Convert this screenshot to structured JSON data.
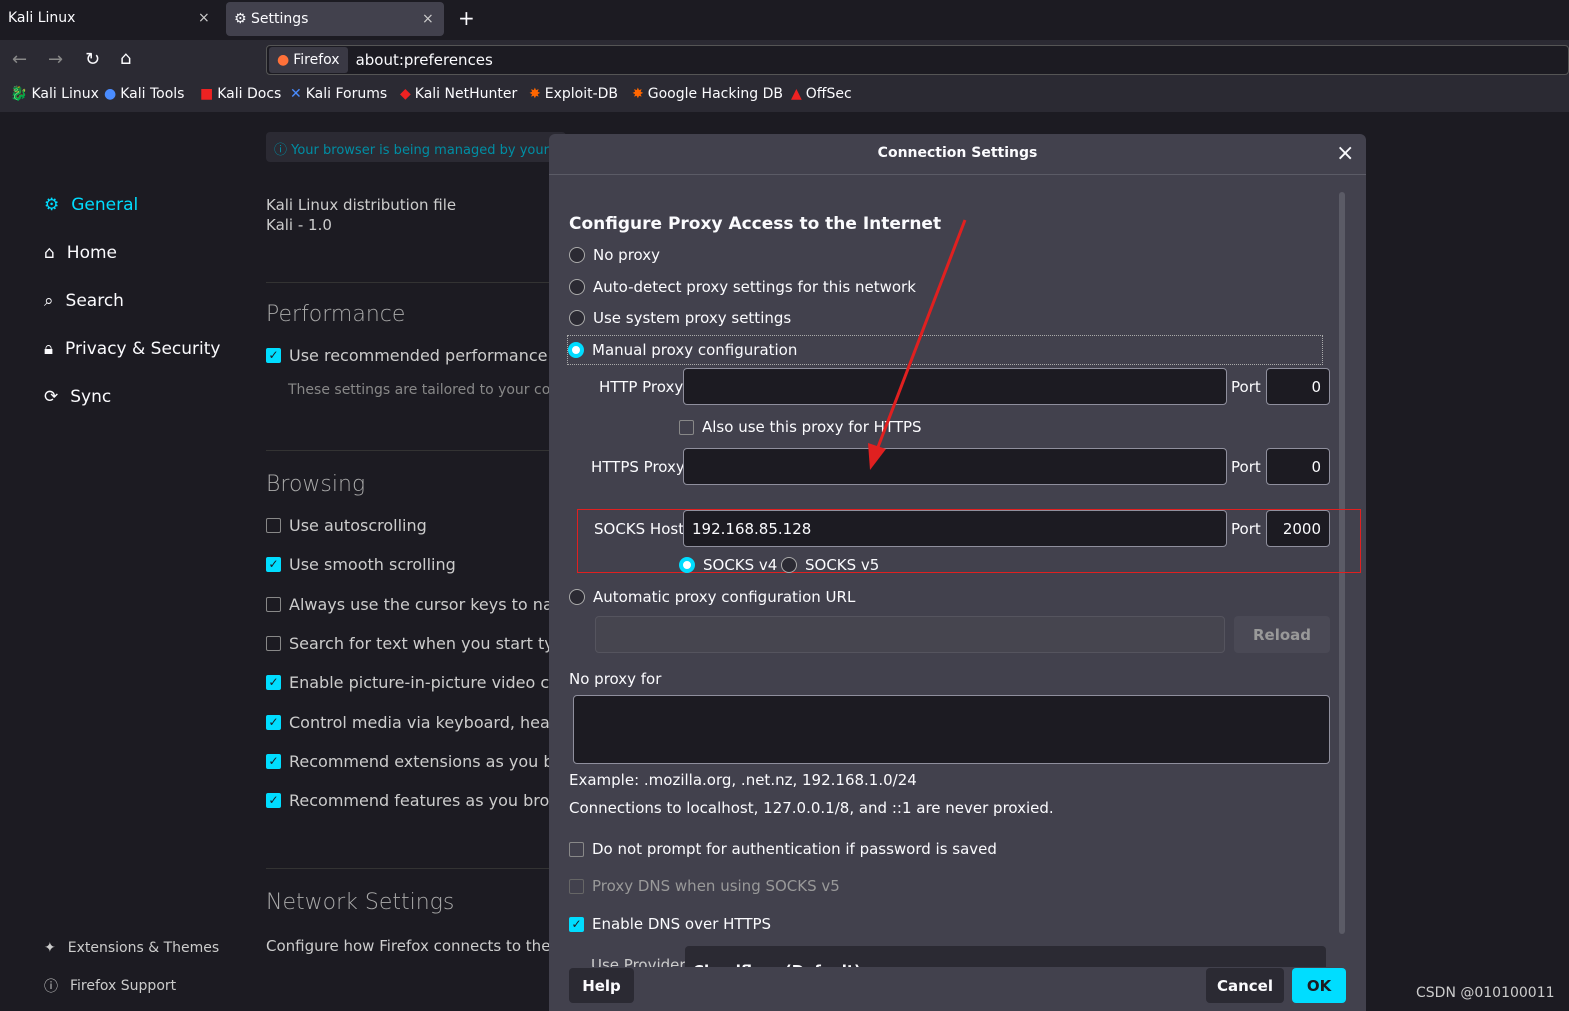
{
  "tabs": [
    {
      "label": "Kali Linux",
      "active": false
    },
    {
      "label": "Settings",
      "active": true
    }
  ],
  "toolbar": {
    "identity": "Firefox",
    "url": "about:preferences"
  },
  "bookmarks": [
    "Kali Linux",
    "Kali Tools",
    "Kali Docs",
    "Kali Forums",
    "Kali NetHunter",
    "Exploit-DB",
    "Google Hacking DB",
    "OffSec"
  ],
  "sidebar": {
    "items": [
      "General",
      "Home",
      "Search",
      "Privacy & Security",
      "Sync"
    ],
    "footer": [
      "Extensions & Themes",
      "Firefox Support"
    ]
  },
  "main": {
    "notice": "Your browser is being managed by your or",
    "dist_line1": "Kali Linux distribution file",
    "dist_line2": "Kali - 1.0",
    "performance": "Performance",
    "perf_check": "Use recommended performance sett",
    "perf_note": "These settings are tailored to your comp",
    "browsing": "Browsing",
    "browse_items": [
      {
        "label": "Use autoscrolling",
        "checked": false
      },
      {
        "label": "Use smooth scrolling",
        "checked": true
      },
      {
        "label": "Always use the cursor keys to naviga",
        "checked": false
      },
      {
        "label": "Search for text when you start typing",
        "checked": false
      },
      {
        "label": "Enable picture-in-picture video cont",
        "checked": true
      },
      {
        "label": "Control media via keyboard, headset",
        "checked": true
      },
      {
        "label": "Recommend extensions as you brow",
        "checked": true
      },
      {
        "label": "Recommend features as you browse",
        "checked": true
      }
    ],
    "network": "Network Settings",
    "network_desc": "Configure how Firefox connects to the i"
  },
  "dialog": {
    "title": "Connection Settings",
    "heading": "Configure Proxy Access to the Internet",
    "options": [
      "No proxy",
      "Auto-detect proxy settings for this network",
      "Use system proxy settings",
      "Manual proxy configuration"
    ],
    "selected": "Manual proxy configuration",
    "http_label": "HTTP Proxy",
    "http_value": "",
    "http_port": "0",
    "port_label": "Port",
    "also_https": "Also use this proxy for HTTPS",
    "https_label": "HTTPS Proxy",
    "https_value": "",
    "https_port": "0",
    "socks_label": "SOCKS Host",
    "socks_value": "192.168.85.128",
    "socks_port": "2000",
    "socks_v4": "SOCKS v4",
    "socks_v5": "SOCKS v5",
    "socks_selected": "SOCKS v4",
    "auto_url": "Automatic proxy configuration URL",
    "reload": "Reload",
    "no_proxy_label": "No proxy for",
    "example": "Example: .mozilla.org, .net.nz, 192.168.1.0/24",
    "localhost_note": "Connections to localhost, 127.0.0.1/8, and ::1 are never proxied.",
    "no_prompt": "Do not prompt for authentication if password is saved",
    "proxy_dns": "Proxy DNS when using SOCKS v5",
    "doh": "Enable DNS over HTTPS",
    "provider_label": "Use Provider",
    "provider_value": "Cloudflare (Default)",
    "help": "Help",
    "cancel": "Cancel",
    "ok": "OK"
  },
  "watermark": "CSDN @010100011",
  "colors": {
    "accent": "#00ddff",
    "highlight": "#e02020"
  }
}
